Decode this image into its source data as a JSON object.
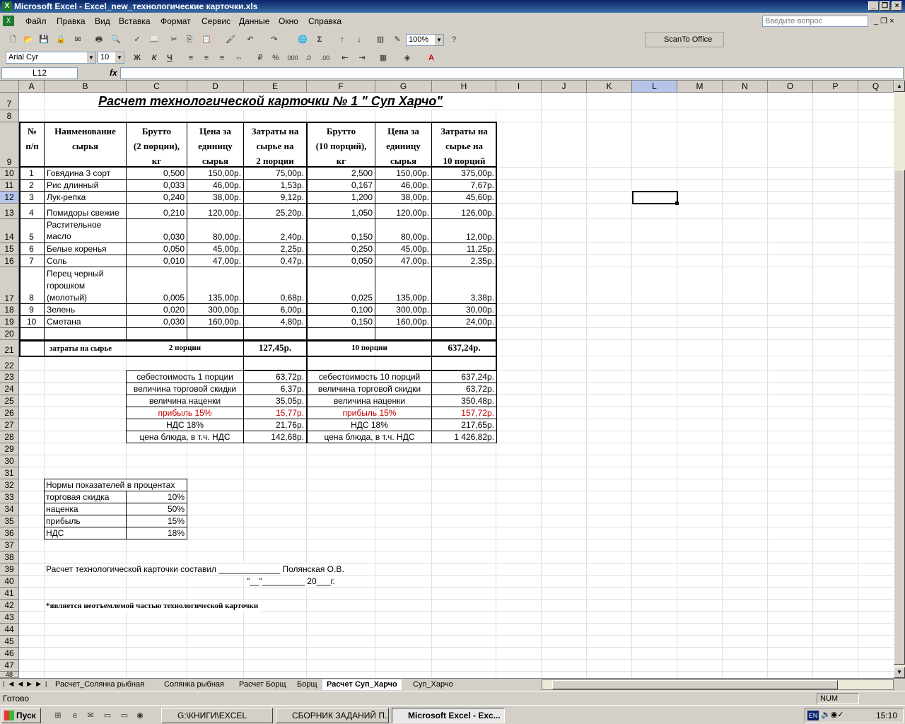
{
  "window": {
    "title": "Microsoft Excel - Excel_new_технологические карточки.xls"
  },
  "menu": {
    "items": [
      "Файл",
      "Правка",
      "Вид",
      "Вставка",
      "Формат",
      "Сервис",
      "Данные",
      "Окно",
      "Справка"
    ],
    "ask_placeholder": "Введите вопрос"
  },
  "toolbar": {
    "zoom": "100%",
    "scanto": "ScanTo Office"
  },
  "format_bar": {
    "font": "Arial Cyr",
    "size": "10",
    "bold": "Ж",
    "italic": "К",
    "underline": "Ч",
    "currency": "%",
    "thousands": "000"
  },
  "formula_bar": {
    "namebox": "L12",
    "fx": "fx",
    "content": ""
  },
  "columns": [
    "A",
    "B",
    "C",
    "D",
    "E",
    "F",
    "G",
    "H",
    "I",
    "J",
    "K",
    "L",
    "M",
    "N",
    "O",
    "P",
    "Q"
  ],
  "rows": [
    "7",
    "8",
    "9",
    "10",
    "11",
    "12",
    "13",
    "14",
    "15",
    "16",
    "17",
    "18",
    "19",
    "20",
    "21",
    "22",
    "23",
    "24",
    "25",
    "26",
    "27",
    "28",
    "29",
    "30",
    "31",
    "32",
    "33",
    "34",
    "35",
    "36",
    "37",
    "38",
    "39",
    "40",
    "41",
    "42",
    "43",
    "44",
    "45",
    "46",
    "47",
    "48"
  ],
  "sheet": {
    "title": "Расчет технологической карточки № 1 \" Суп Харчо\"",
    "headers": {
      "num": [
        "№",
        "п/п"
      ],
      "name": [
        "Наименование",
        "сырья"
      ],
      "brutto2": [
        "Брутто",
        "(2 порции),",
        "кг"
      ],
      "price": [
        "Цена за",
        "единицу",
        "сырья"
      ],
      "cost2": [
        "Затраты на",
        "сырье на",
        "2 порции"
      ],
      "brutto10": [
        "Брутто",
        "(10 порций),",
        "кг"
      ],
      "price10": [
        "Цена за",
        "единицу",
        "сырья"
      ],
      "cost10": [
        "Затраты на",
        "сырье на",
        "10 порций"
      ]
    },
    "items": [
      {
        "n": "1",
        "name": [
          "Говядина 3 сорт"
        ],
        "b2": "0,500",
        "p": "150,00р.",
        "c2": "75,00р.",
        "b10": "2,500",
        "p10": "150,00р.",
        "c10": "375,00р."
      },
      {
        "n": "2",
        "name": [
          "Рис длинный"
        ],
        "b2": "0,033",
        "p": "46,00р.",
        "c2": "1,53р.",
        "b10": "0,167",
        "p10": "46,00р.",
        "c10": "7,67р."
      },
      {
        "n": "3",
        "name": [
          "Лук-репка"
        ],
        "b2": "0,240",
        "p": "38,00р.",
        "c2": "9,12р.",
        "b10": "1,200",
        "p10": "38,00р.",
        "c10": "45,60р."
      },
      {
        "n": "4",
        "name": [
          "Помидоры свежие"
        ],
        "b2": "0,210",
        "p": "120,00р.",
        "c2": "25,20р.",
        "b10": "1,050",
        "p10": "120,00р.",
        "c10": "126,00р."
      },
      {
        "n": "5",
        "name": [
          "Растительное",
          "масло"
        ],
        "b2": "0,030",
        "p": "80,00р.",
        "c2": "2,40р.",
        "b10": "0,150",
        "p10": "80,00р.",
        "c10": "12,00р."
      },
      {
        "n": "6",
        "name": [
          "Белые коренья"
        ],
        "b2": "0,050",
        "p": "45,00р.",
        "c2": "2,25р.",
        "b10": "0,250",
        "p10": "45,00р.",
        "c10": "11,25р."
      },
      {
        "n": "7",
        "name": [
          "Соль"
        ],
        "b2": "0,010",
        "p": "47,00р.",
        "c2": "0,47р.",
        "b10": "0,050",
        "p10": "47,00р.",
        "c10": "2,35р."
      },
      {
        "n": "8",
        "name": [
          "Перец черный",
          "горошком",
          "(молотый)"
        ],
        "b2": "0,005",
        "p": "135,00р.",
        "c2": "0,68р.",
        "b10": "0,025",
        "p10": "135,00р.",
        "c10": "3,38р."
      },
      {
        "n": "9",
        "name": [
          "Зелень"
        ],
        "b2": "0,020",
        "p": "300,00р.",
        "c2": "6,00р.",
        "b10": "0,100",
        "p10": "300,00р.",
        "c10": "30,00р."
      },
      {
        "n": "10",
        "name": [
          "Сметана"
        ],
        "b2": "0,030",
        "p": "160,00р.",
        "c2": "4,80р.",
        "b10": "0,150",
        "p10": "160,00р.",
        "c10": "24,00р."
      }
    ],
    "totals": {
      "label": "затраты на сырье",
      "p2_label": "2 порции",
      "p2": "127,45р.",
      "p10_label": "10 порции",
      "p10": "637,24р."
    },
    "calc": [
      {
        "l1": "себестоимость 1 порции",
        "v1": "63,72р.",
        "l2": "себестоимость 10 порций",
        "v2": "637,24р."
      },
      {
        "l1": "величина торговой скидки",
        "v1": "6,37р.",
        "l2": "величина торговой скидки",
        "v2": "63,72р."
      },
      {
        "l1": "величина наценки",
        "v1": "35,05р.",
        "l2": "величина наценки",
        "v2": "350,48р."
      },
      {
        "l1": "прибыль 15%",
        "v1": "15,77р.",
        "l2": "прибыль 15%",
        "v2": "157,72р."
      },
      {
        "l1": "НДС 18%",
        "v1": "21,76р.",
        "l2": "НДС 18%",
        "v2": "217,65р."
      },
      {
        "l1": "цена блюда, в т.ч. НДС",
        "v1": "142,68р.",
        "l2": "цена блюда, в т.ч. НДС",
        "v2": "1 426,82р."
      }
    ],
    "norms": {
      "title": "Нормы показателей в процентах",
      "rows": [
        {
          "k": "торговая скидка",
          "v": "10%"
        },
        {
          "k": "наценка",
          "v": "50%"
        },
        {
          "k": "прибыль",
          "v": "15%"
        },
        {
          "k": "НДС",
          "v": "18%"
        }
      ]
    },
    "signature": {
      "line1": "Расчет технологической карточки составил _____________ Полянская О.В.",
      "line2": "\"__\"_________ 20___г."
    },
    "footnote": "*является неотъемлемой частью технологической карточки"
  },
  "tabs": [
    "Расчет_Солянка рыбная",
    "Солянка рыбная",
    "Расчет Борщ",
    "Борщ",
    "Расчет Суп_Харчо",
    "Суп_Харчо"
  ],
  "status": {
    "ready": "Готово",
    "num": "NUM"
  },
  "taskbar": {
    "start": "Пуск",
    "tasks": [
      "G:\\КНИГИ\\EXCEL",
      "СБОРНИК ЗАДАНИЙ П...",
      "Microsoft Excel - Exc..."
    ],
    "lang": "EN",
    "time": "15:10"
  }
}
